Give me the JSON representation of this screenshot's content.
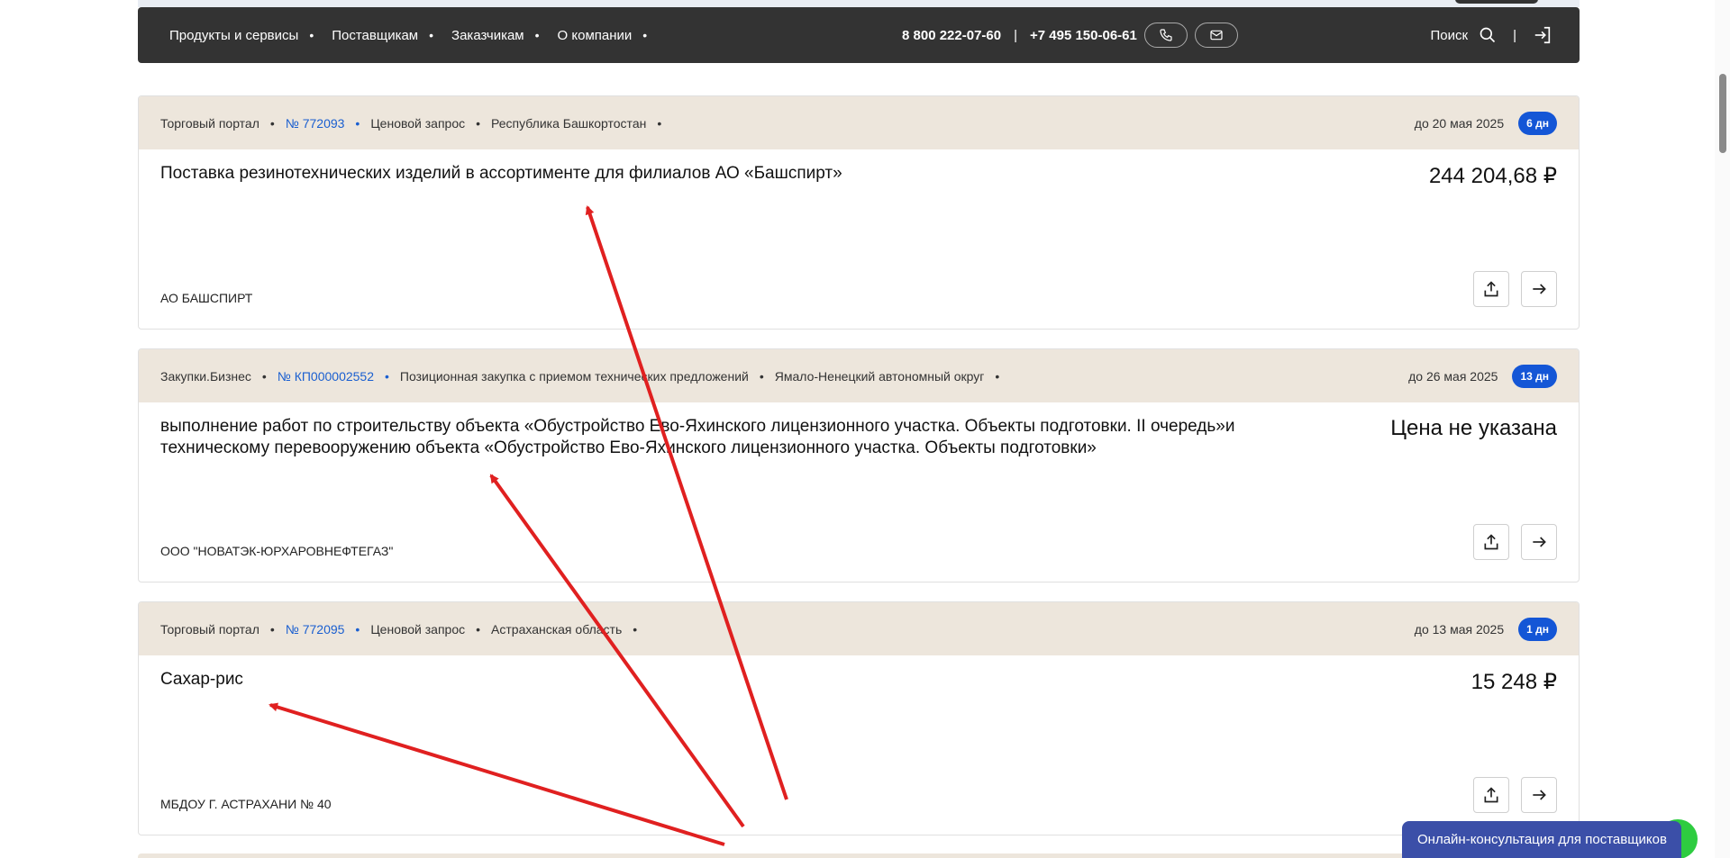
{
  "navbar": {
    "links": [
      "Продукты и сервисы",
      "Поставщикам",
      "Заказчикам",
      "О компании"
    ],
    "phone1": "8 800 222-07-60",
    "phone_sep": "|",
    "phone2": "+7 495 150-06-61",
    "search_label": "Поиск",
    "divider": "|"
  },
  "cards": [
    {
      "source": "Торговый портал",
      "number": "№ 772093",
      "type": "Ценовой запрос",
      "region": "Республика Башкортостан",
      "deadline": "до 20 мая 2025",
      "days_left": "6 дн",
      "title": "Поставка резинотехнических изделий в ассортименте для филиалов АО «Башспирт»",
      "price": "244 204,68 ₽",
      "organization": "АО БАШСПИРТ"
    },
    {
      "source": "Закупки.Бизнес",
      "number": "№ КП000002552",
      "type": "Позиционная закупка с приемом технических предложений",
      "region": "Ямало-Ненецкий автономный округ",
      "deadline": "до 26 мая 2025",
      "days_left": "13 дн",
      "title": "выполнение работ по строительству объекта «Обустройство Ево-Яхинского лицензионного участка. Объекты подготовки. II очередь»и техническому перевооружению объекта «Обустройство Ево-Яхинского лицензионного участка. Объекты подготовки»",
      "price": "Цена не указана",
      "organization": "ООО \"НОВАТЭК-ЮРХАРОВНЕФТЕГАЗ\""
    },
    {
      "source": "Торговый портал",
      "number": "№ 772095",
      "type": "Ценовой запрос",
      "region": "Астраханская область",
      "deadline": "до 13 мая 2025",
      "days_left": "1 дн",
      "title": "Сахар-рис",
      "price": "15 248 ₽",
      "organization": "МБДОУ Г. АСТРАХАНИ № 40"
    }
  ],
  "consult_widget": {
    "label": "Онлайн-консультация для поставщиков"
  },
  "colors": {
    "navbar_bg": "#333333",
    "card_header_bg": "#ede6dc",
    "link_blue": "#1a5fd0",
    "badge_blue": "#1456d6",
    "annotation_arrow": "#e02020",
    "consult_bg": "#3b4fa8"
  },
  "icons": [
    "phone-icon",
    "mail-icon",
    "search-icon",
    "login-icon",
    "share-icon",
    "arrow-right-icon"
  ]
}
